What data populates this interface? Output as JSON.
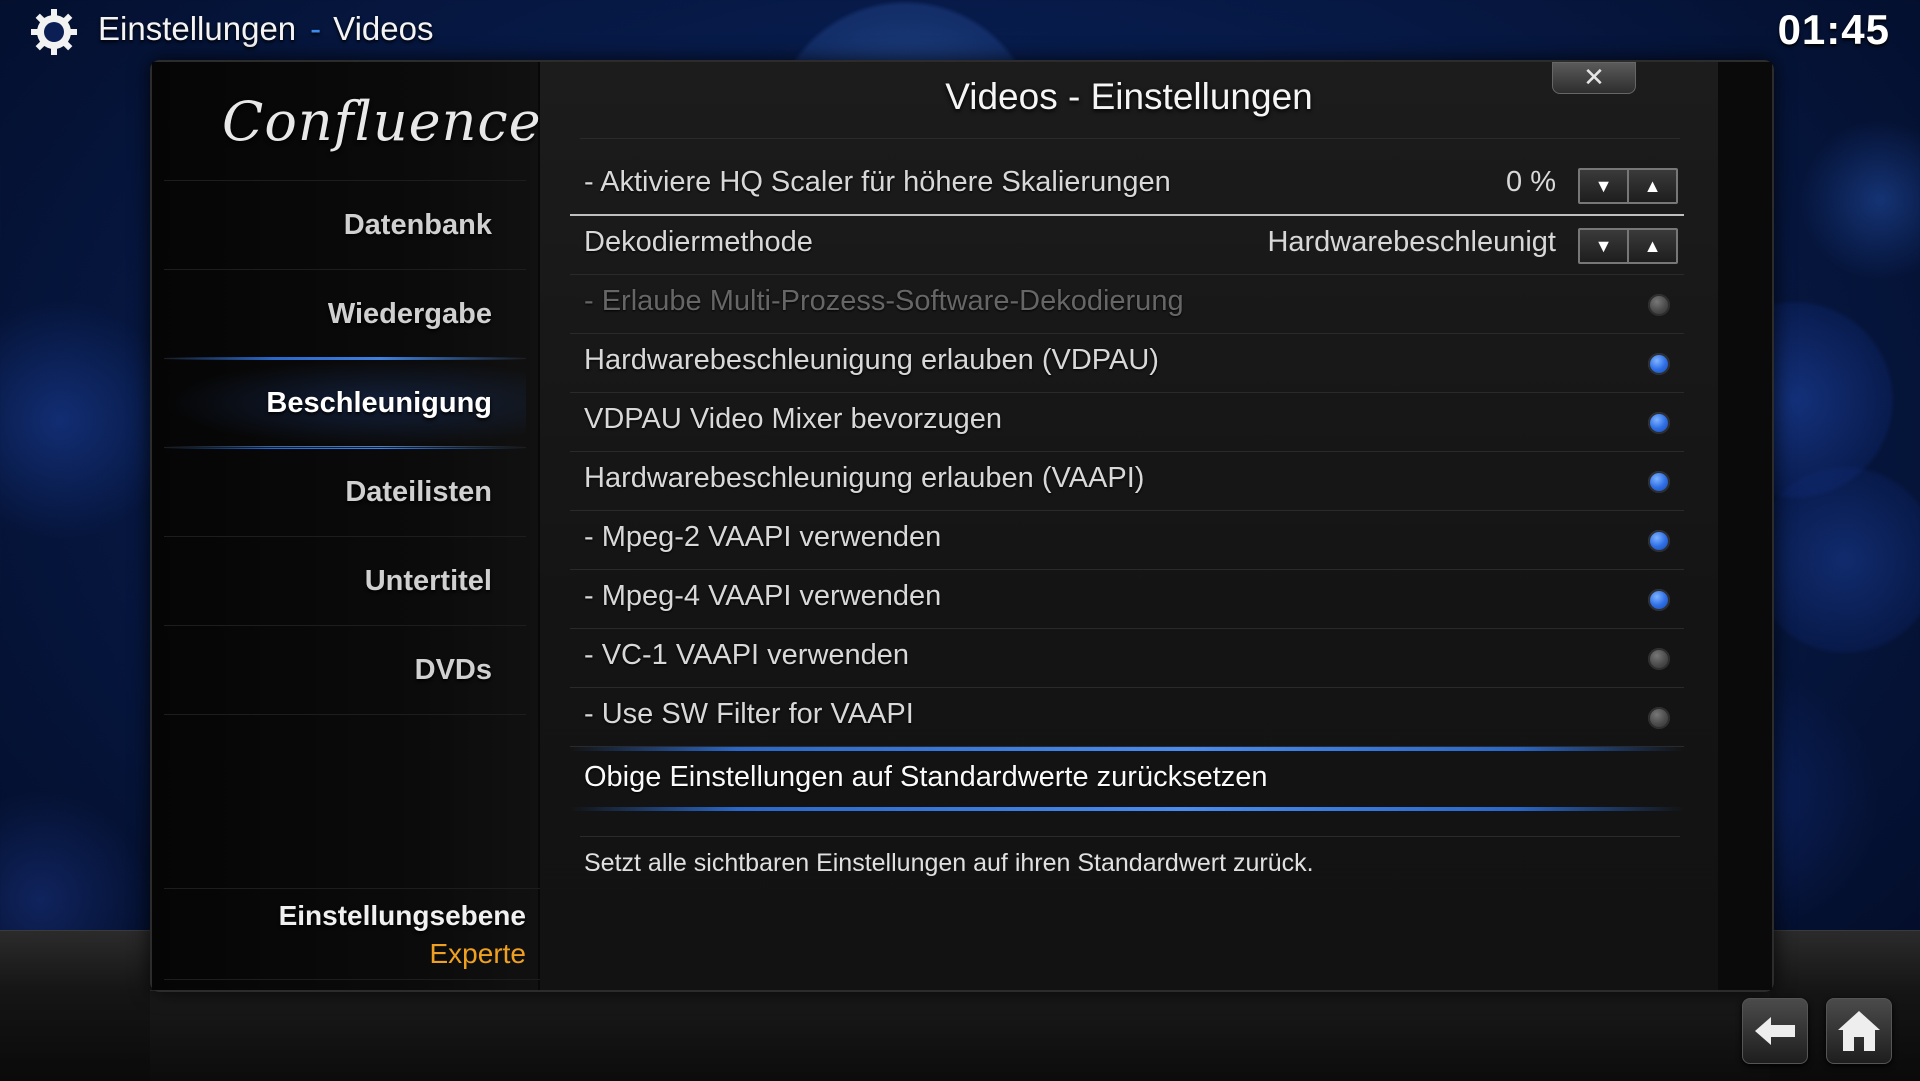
{
  "header": {
    "section": "Einstellungen",
    "separator": "-",
    "subsection": "Videos",
    "clock": "01:45"
  },
  "sidebar": {
    "logo": "Confluence",
    "items": [
      {
        "label": "Datenbank",
        "active": false
      },
      {
        "label": "Wiedergabe",
        "active": false
      },
      {
        "label": "Beschleunigung",
        "active": true
      },
      {
        "label": "Dateilisten",
        "active": false
      },
      {
        "label": "Untertitel",
        "active": false
      },
      {
        "label": "DVDs",
        "active": false
      }
    ],
    "level_label": "Einstellungsebene",
    "level_value": "Experte"
  },
  "dialog": {
    "title": "Videos - Einstellungen",
    "close_glyph": "✕",
    "settings": [
      {
        "label": "- Aktiviere HQ Scaler für höhere Skalierungen",
        "type": "spinner",
        "value": "0 %",
        "focused": true
      },
      {
        "label": "Dekodiermethode",
        "type": "spinner",
        "value": "Hardwarebeschleunigt"
      },
      {
        "label": "- Erlaube Multi-Prozess-Software-Dekodierung",
        "type": "toggle",
        "on": false,
        "disabled": true
      },
      {
        "label": "Hardwarebeschleunigung erlauben (VDPAU)",
        "type": "toggle",
        "on": true
      },
      {
        "label": "VDPAU Video Mixer bevorzugen",
        "type": "toggle",
        "on": true
      },
      {
        "label": "Hardwarebeschleunigung erlauben (VAAPI)",
        "type": "toggle",
        "on": true
      },
      {
        "label": "- Mpeg-2 VAAPI verwenden",
        "type": "toggle",
        "on": true
      },
      {
        "label": "- Mpeg-4 VAAPI verwenden",
        "type": "toggle",
        "on": true
      },
      {
        "label": "- VC-1 VAAPI verwenden",
        "type": "toggle",
        "on": false
      },
      {
        "label": "- Use SW Filter for VAAPI",
        "type": "toggle",
        "on": false
      }
    ],
    "reset_label": "Obige Einstellungen auf Standardwerte zurücksetzen",
    "description": "Setzt alle sichtbaren Einstellungen auf ihren Standardwert zurück."
  },
  "colors": {
    "accent": "#3c8cf0",
    "level_value": "#f0a020",
    "toggle_on": "#2f6fe6"
  },
  "icons": {
    "header": "gear-icon",
    "close": "close-icon",
    "back": "back-arrow-icon",
    "home": "home-icon",
    "spinner_down": "triangle-down-icon",
    "spinner_up": "triangle-up-icon"
  }
}
